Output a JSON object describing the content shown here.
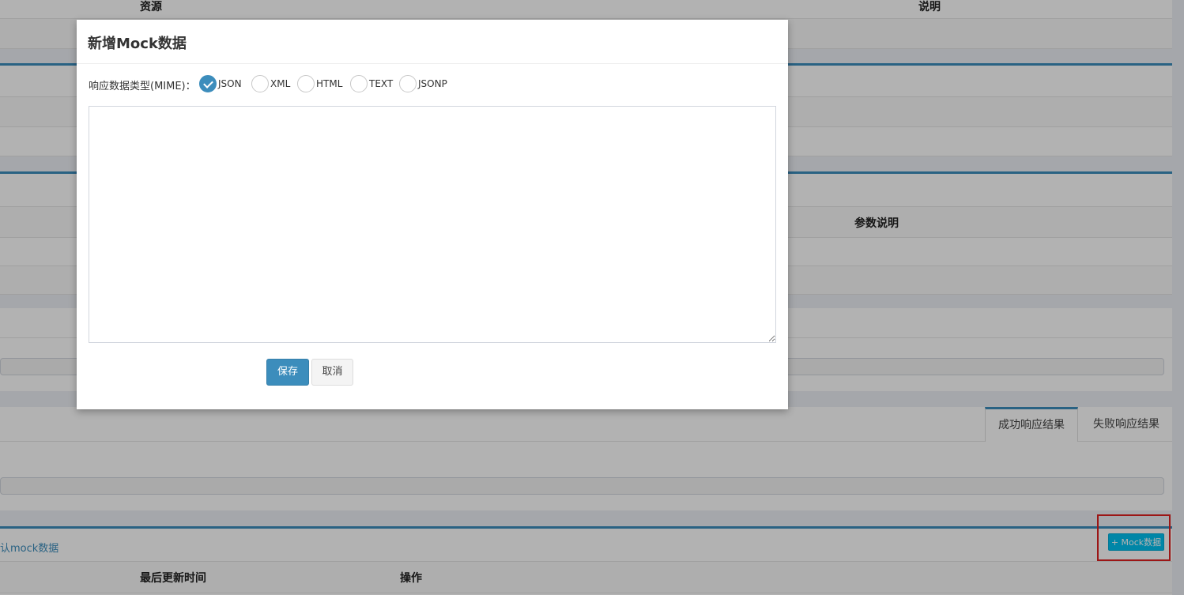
{
  "background": {
    "resource_header": "资源",
    "desc_header": "说明",
    "param_desc_header": "参数说明",
    "tabs": [
      {
        "label": "成功响应结果",
        "active": true
      },
      {
        "label": "失败响应结果",
        "active": false
      }
    ],
    "default_mock_link": "认mock数据",
    "add_mock_button": "+ Mock数据",
    "last_update_header": "最后更新时间",
    "operation_header": "操作"
  },
  "modal": {
    "title": "新增Mock数据",
    "mime_label": "响应数据类型(MIME)：",
    "mime_options": [
      {
        "label": "JSON",
        "checked": true
      },
      {
        "label": "XML",
        "checked": false
      },
      {
        "label": "HTML",
        "checked": false
      },
      {
        "label": "TEXT",
        "checked": false
      },
      {
        "label": "JSONP",
        "checked": false
      }
    ],
    "textarea_value": "",
    "save_label": "保存",
    "cancel_label": "取消"
  },
  "colors": {
    "primary": "#3c8dbc",
    "info": "#00c0ef",
    "highlight_box": "#e02020"
  }
}
